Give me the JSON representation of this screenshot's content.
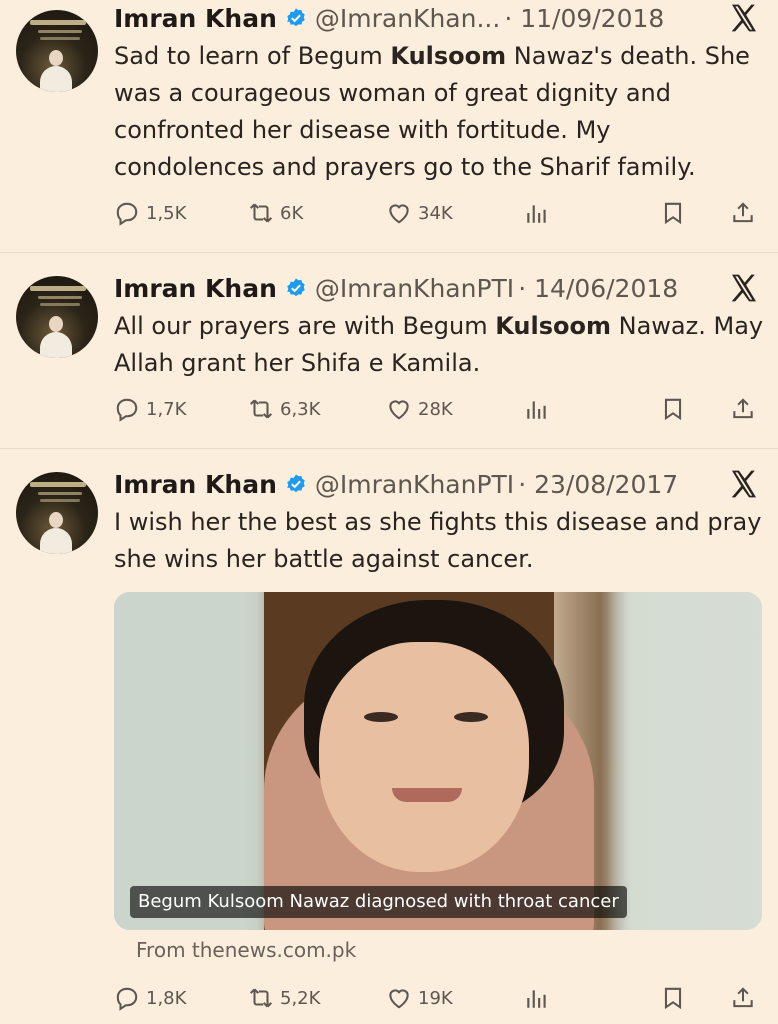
{
  "tweets": [
    {
      "name": "Imran Khan",
      "handle": "@ImranKhan...",
      "date": "· 11/09/2018",
      "text_before": "Sad to learn of Begum ",
      "text_bold": "Kulsoom",
      "text_after": " Nawaz's death. She was a courageous woman of great dignity and confronted her disease with fortitude. My condolences and prayers go to the Sharif family.",
      "replies": "1,5K",
      "reposts": "6K",
      "likes": "34K"
    },
    {
      "name": "Imran Khan",
      "handle": "@ImranKhanPTI",
      "date": "· 14/06/2018",
      "text_before": "All our prayers are with Begum  ",
      "text_bold": "Kulsoom",
      "text_after": " Nawaz. May Allah grant her Shifa e Kamila.",
      "replies": "1,7K",
      "reposts": "6,3K",
      "likes": "28K"
    },
    {
      "name": "Imran Khan",
      "handle": "@ImranKhanPTI",
      "date": "· 23/08/2017",
      "text": "I wish her the best as she fights this disease and pray she wins her battle against cancer.",
      "replies": "1,8K",
      "reposts": "5,2K",
      "likes": "19K",
      "media_caption": "Begum Kulsoom Nawaz diagnosed with throat cancer",
      "source": "From thenews.com.pk"
    }
  ],
  "colors": {
    "background": "#fbeedd",
    "verified": "#1d9bf0",
    "icon": "#5e5750"
  },
  "icons": [
    "x-logo-icon",
    "verified-badge-icon",
    "reply-icon",
    "repost-icon",
    "like-icon",
    "views-icon",
    "bookmark-icon",
    "share-icon"
  ]
}
